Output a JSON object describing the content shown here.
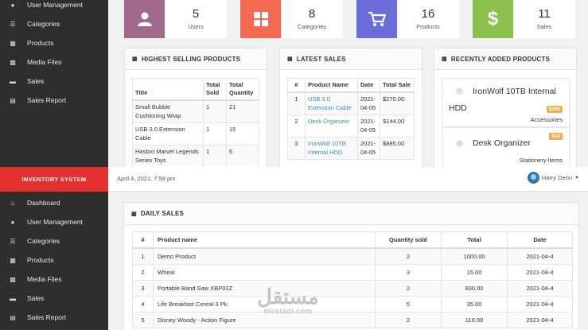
{
  "top_sidebar": {
    "items": [
      {
        "label": "User Management",
        "icon": "user-icon"
      },
      {
        "label": "Categories",
        "icon": "categories-icon"
      },
      {
        "label": "Products",
        "icon": "products-icon"
      },
      {
        "label": "Media Files",
        "icon": "image-icon"
      },
      {
        "label": "Sales",
        "icon": "sales-icon"
      },
      {
        "label": "Sales Report",
        "icon": "report-icon"
      }
    ]
  },
  "stats": [
    {
      "value": "5",
      "label": "Users",
      "color": "#a3698b",
      "icon": "user-icon"
    },
    {
      "value": "8",
      "label": "Categories",
      "color": "#f4694f",
      "icon": "grid-icon"
    },
    {
      "value": "16",
      "label": "Products",
      "color": "#6c6cdb",
      "icon": "cart-icon"
    },
    {
      "value": "11",
      "label": "Sales",
      "color": "#8bbf4e",
      "icon": "dollar-icon"
    }
  ],
  "highest": {
    "title": "HIGHEST SELLING PRODUCTS",
    "headers": [
      "Title",
      "Total Sold",
      "Total Quantity"
    ],
    "rows": [
      [
        "Small Bubble Cushioning Wrap",
        "1",
        "21"
      ],
      [
        "USB 3.0 Extension Cable",
        "1",
        "15"
      ],
      [
        "Hasbro Marvel Legends Series Toys",
        "1",
        "6"
      ]
    ]
  },
  "latest": {
    "title": "LATEST SALES",
    "headers": [
      "#",
      "Product Name",
      "Date",
      "Total Sale"
    ],
    "rows": [
      [
        "1",
        "USB 3.0 Extension Cable",
        "2021-04-05",
        "$270.00"
      ],
      [
        "2",
        "Desk Organizer",
        "2021-04-05",
        "$144.00"
      ],
      [
        "3",
        "IronWolf 10TB Internal HDD",
        "2021-04-05",
        "$885.00"
      ]
    ]
  },
  "recent": {
    "title": "RECENTLY ADDED PRODUCTS",
    "items": [
      {
        "name": "IronWolf 10TB Internal HDD",
        "price": "$295",
        "category": "Accessories"
      },
      {
        "name": "Desk Organizer",
        "price": "$24",
        "category": "Stationery Items"
      }
    ]
  },
  "brand": "INVENTORY SYSTEM",
  "topbar": {
    "date": "April 4, 2021, 7:58 pm",
    "user": "Harry Denn"
  },
  "bottom_sidebar": {
    "items": [
      {
        "label": "Dashboard",
        "icon": "home-icon"
      },
      {
        "label": "User Management",
        "icon": "user-icon"
      },
      {
        "label": "Categories",
        "icon": "categories-icon"
      },
      {
        "label": "Products",
        "icon": "products-icon"
      },
      {
        "label": "Media Files",
        "icon": "image-icon"
      },
      {
        "label": "Sales",
        "icon": "sales-icon"
      },
      {
        "label": "Sales Report",
        "icon": "report-icon"
      }
    ]
  },
  "daily": {
    "title": "DAILY SALES",
    "headers": [
      "#",
      "Product name",
      "Quantity sold",
      "Total",
      "Date"
    ],
    "rows": [
      [
        "1",
        "Demo Product",
        "2",
        "1000.00",
        "2021-04-4"
      ],
      [
        "2",
        "Wheat",
        "3",
        "15.00",
        "2021-04-4"
      ],
      [
        "3",
        "Portable Band Saw XBP02Z",
        "2",
        "830.00",
        "2021-04-4"
      ],
      [
        "4",
        "Life Breakfast Cereal-3 Pk",
        "5",
        "35.00",
        "2021-04-4"
      ],
      [
        "5",
        "Disney Woody - Action Figure",
        "2",
        "110.00",
        "2021-04-4"
      ]
    ]
  },
  "watermark": {
    "arabic": "مستقل",
    "latin": "mostaql.com"
  }
}
